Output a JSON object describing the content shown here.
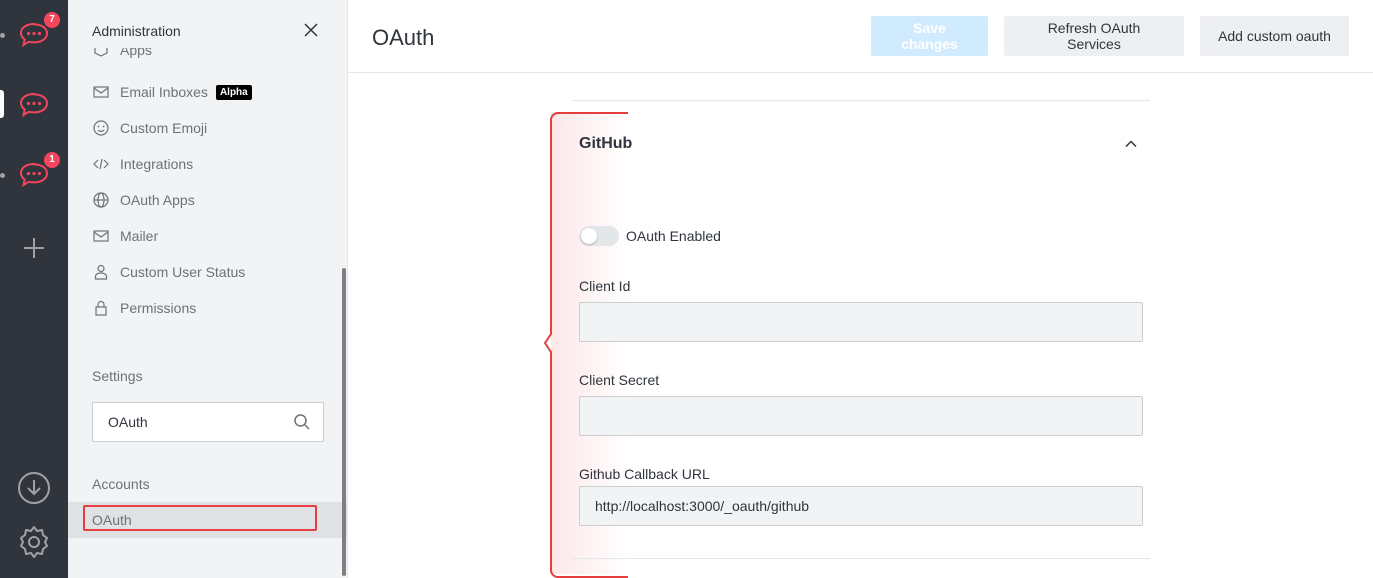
{
  "rail": {
    "workspaces": [
      {
        "badge": "7"
      },
      {
        "badge": ""
      },
      {
        "badge": "1"
      }
    ]
  },
  "sidebar": {
    "title": "Administration",
    "nav_items": [
      {
        "label": "Apps",
        "icon": "cube-icon"
      },
      {
        "label": "Email Inboxes",
        "icon": "mail-icon",
        "tag": "Alpha"
      },
      {
        "label": "Custom Emoji",
        "icon": "emoji-icon"
      },
      {
        "label": "Integrations",
        "icon": "code-icon"
      },
      {
        "label": "OAuth Apps",
        "icon": "globe-icon"
      },
      {
        "label": "Mailer",
        "icon": "mail-icon"
      },
      {
        "label": "Custom User Status",
        "icon": "user-icon"
      },
      {
        "label": "Permissions",
        "icon": "lock-icon"
      }
    ],
    "settings_title": "Settings",
    "search": {
      "value": "OAuth",
      "placeholder": "Search"
    },
    "group_title": "Accounts",
    "selected_item": "OAuth"
  },
  "header": {
    "title": "OAuth",
    "save_label": "Save changes",
    "refresh_label": "Refresh OAuth Services",
    "add_label": "Add custom oauth"
  },
  "panel": {
    "section_title": "GitHub",
    "toggle_label": "OAuth Enabled",
    "toggle_on": false,
    "client_id_label": "Client Id",
    "client_id_value": "",
    "client_secret_label": "Client Secret",
    "client_secret_value": "",
    "callback_label": "Github Callback URL",
    "callback_value": "http://localhost:3000/_oauth/github"
  },
  "colors": {
    "accent": "#1d74f5",
    "rail_bg": "#2f343d",
    "badge": "#f5455c",
    "highlight": "#e53e3e"
  }
}
